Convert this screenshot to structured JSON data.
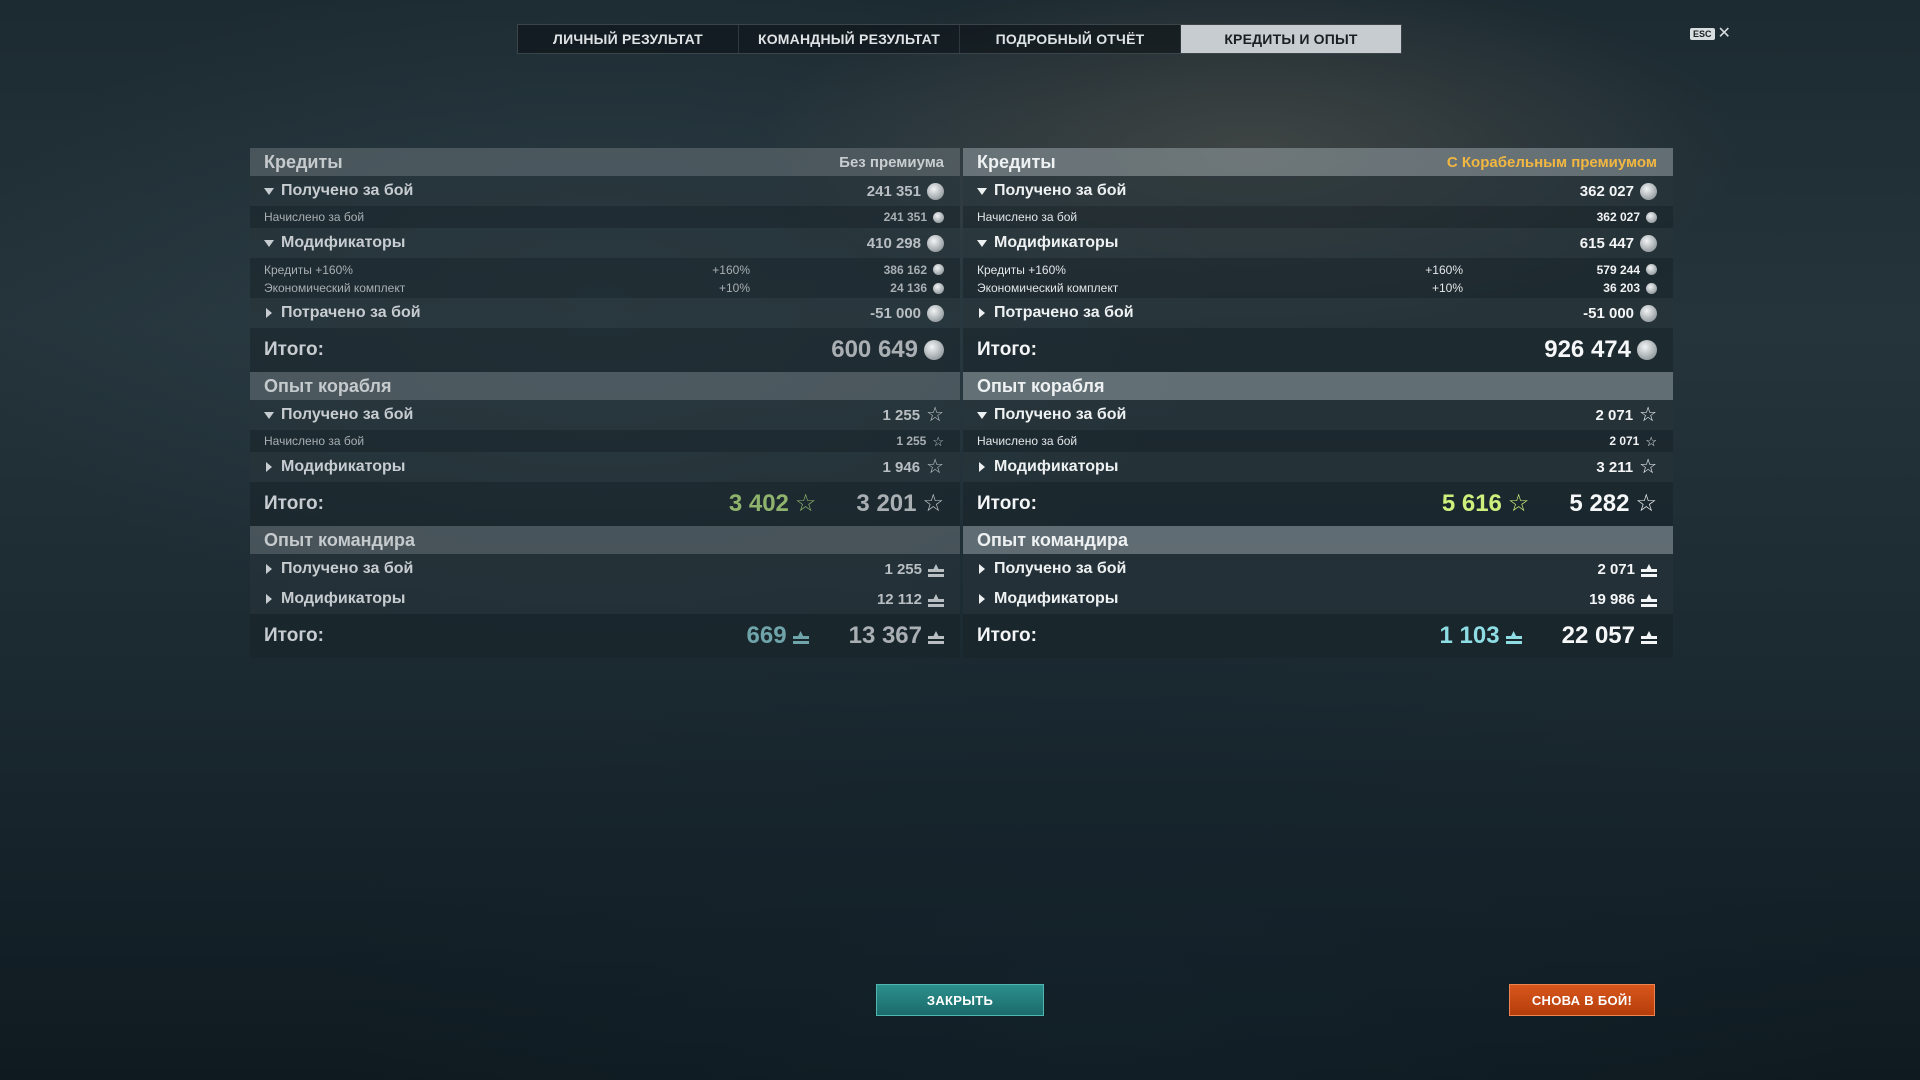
{
  "tabs": [
    {
      "label": "ЛИЧНЫЙ РЕЗУЛЬТАТ",
      "active": false
    },
    {
      "label": "КОМАНДНЫЙ РЕЗУЛЬТАТ",
      "active": false
    },
    {
      "label": "ПОДРОБНЫЙ ОТЧЁТ",
      "active": false
    },
    {
      "label": "КРЕДИТЫ И ОПЫТ",
      "active": true
    }
  ],
  "esc": {
    "badge": "ESC",
    "close_glyph": "✕"
  },
  "colors": {
    "premium_label": "#f2b740",
    "close_button": "#1f7a78",
    "battle_button": "#c8480f",
    "xp_total_green": "#cdf07c",
    "cmd_total_teal": "#8fdde4"
  },
  "icons": {
    "credits": "credit-coin-icon",
    "xp": "star-icon",
    "commander_xp": "commander-xp-icon"
  },
  "left": {
    "credits": {
      "title": "Кредиты",
      "subtitle": "Без премиума",
      "earned": {
        "label": "Получено за бой",
        "value": "241 351"
      },
      "accrued": {
        "label": "Начислено за бой",
        "value": "241 351"
      },
      "modifiers": {
        "label": "Модификаторы",
        "value": "410 298"
      },
      "mod_credits": {
        "label": "Кредиты +160%",
        "pct": "+160%",
        "value": "386 162"
      },
      "mod_econ": {
        "label": "Экономический комплект",
        "pct": "+10%",
        "value": "24 136"
      },
      "spent": {
        "label": "Потрачено за бой",
        "value": "-51 000"
      },
      "total": {
        "label": "Итого:",
        "value": "600 649"
      }
    },
    "ship_xp": {
      "title": "Опыт корабля",
      "earned": {
        "label": "Получено за бой",
        "value": "1 255"
      },
      "accrued": {
        "label": "Начислено за бой",
        "value": "1 255"
      },
      "modifiers": {
        "label": "Модификаторы",
        "value": "1 946"
      },
      "total": {
        "label": "Итого:",
        "free_value": "3 402",
        "value": "3 201"
      }
    },
    "cmd_xp": {
      "title": "Опыт командира",
      "earned": {
        "label": "Получено за бой",
        "value": "1 255"
      },
      "modifiers": {
        "label": "Модификаторы",
        "value": "12 112"
      },
      "total": {
        "label": "Итого:",
        "free_value": "669",
        "value": "13 367"
      }
    }
  },
  "right": {
    "credits": {
      "title": "Кредиты",
      "subtitle": "С Корабельным премиумом",
      "earned": {
        "label": "Получено за бой",
        "value": "362 027"
      },
      "accrued": {
        "label": "Начислено за бой",
        "value": "362 027"
      },
      "modifiers": {
        "label": "Модификаторы",
        "value": "615 447"
      },
      "mod_credits": {
        "label": "Кредиты +160%",
        "pct": "+160%",
        "value": "579 244"
      },
      "mod_econ": {
        "label": "Экономический комплект",
        "pct": "+10%",
        "value": "36 203"
      },
      "spent": {
        "label": "Потрачено за бой",
        "value": "-51 000"
      },
      "total": {
        "label": "Итого:",
        "value": "926 474"
      }
    },
    "ship_xp": {
      "title": "Опыт корабля",
      "earned": {
        "label": "Получено за бой",
        "value": "2 071"
      },
      "accrued": {
        "label": "Начислено за бой",
        "value": "2 071"
      },
      "modifiers": {
        "label": "Модификаторы",
        "value": "3 211"
      },
      "total": {
        "label": "Итого:",
        "free_value": "5 616",
        "value": "5 282"
      }
    },
    "cmd_xp": {
      "title": "Опыт командира",
      "earned": {
        "label": "Получено за бой",
        "value": "2 071"
      },
      "modifiers": {
        "label": "Модификаторы",
        "value": "19 986"
      },
      "total": {
        "label": "Итого:",
        "free_value": "1 103",
        "value": "22 057"
      }
    }
  },
  "buttons": {
    "close": "ЗАКРЫТЬ",
    "battle_again": "СНОВА В БОЙ!"
  }
}
